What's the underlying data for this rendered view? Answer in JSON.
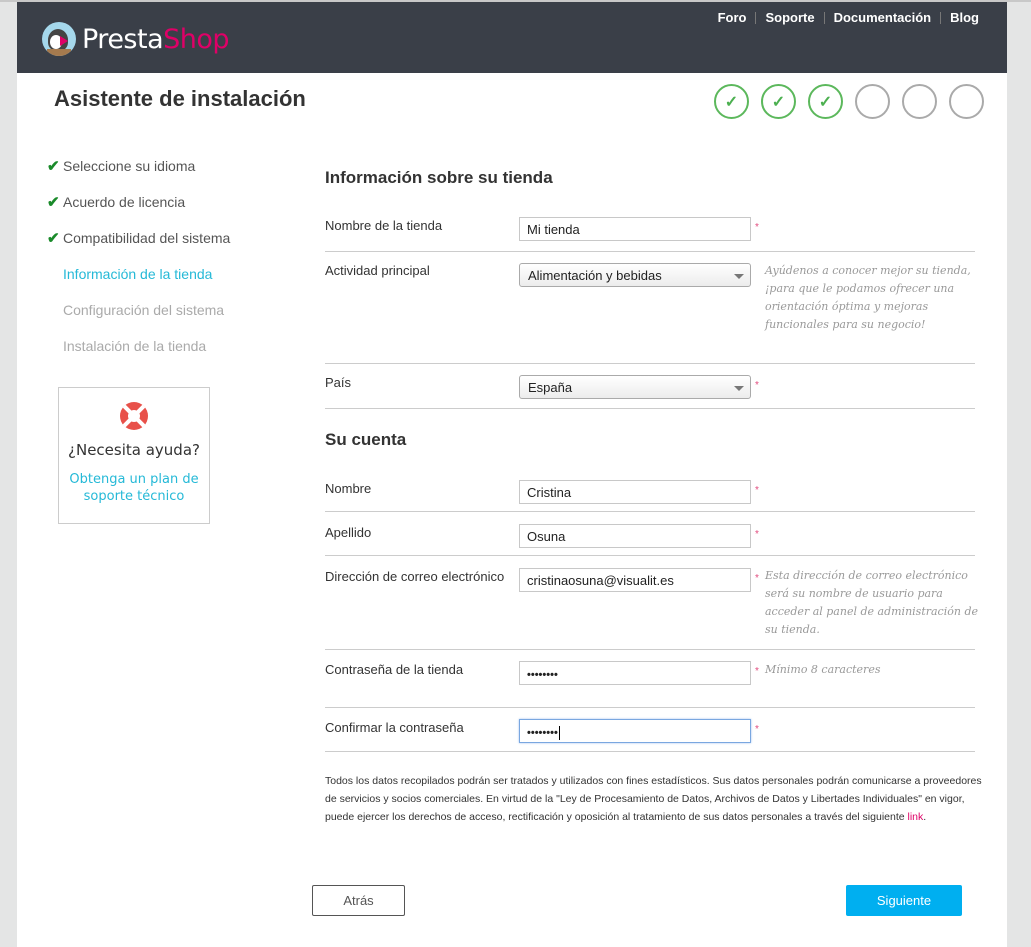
{
  "header": {
    "logo": {
      "part1": "Presta",
      "part2": "Shop"
    },
    "nav": [
      "Foro",
      "Soporte",
      "Documentación",
      "Blog"
    ]
  },
  "wizard": {
    "title": "Asistente de instalación",
    "progress": {
      "completed_steps": 3,
      "total_steps": 6
    },
    "step_check_glyph": "✓"
  },
  "sidebar": {
    "items": [
      {
        "label": "Seleccione su idioma",
        "state": "done"
      },
      {
        "label": "Acuerdo de licencia",
        "state": "done"
      },
      {
        "label": "Compatibilidad del sistema",
        "state": "done"
      },
      {
        "label": "Información de la tienda",
        "state": "current"
      },
      {
        "label": "Configuración del sistema",
        "state": "pending"
      },
      {
        "label": "Instalación de la tienda",
        "state": "pending"
      }
    ],
    "check_glyph": "✔"
  },
  "help": {
    "title": "¿Necesita ayuda?",
    "link": "Obtenga un plan de soporte técnico"
  },
  "store_section": {
    "title": "Información sobre su tienda",
    "store_name": {
      "label": "Nombre de la tienda",
      "value": "Mi tienda",
      "required": "*"
    },
    "activity": {
      "label": "Actividad principal",
      "value": "Alimentación y bebidas",
      "hint": "Ayúdenos a conocer mejor su tienda, ¡para que le podamos ofrecer una orientación óptima y mejoras funcionales para su negocio!"
    },
    "country": {
      "label": "País",
      "value": "España",
      "required": "*"
    }
  },
  "account_section": {
    "title": "Su cuenta",
    "first_name": {
      "label": "Nombre",
      "value": "Cristina",
      "required": "*"
    },
    "last_name": {
      "label": "Apellido",
      "value": "Osuna",
      "required": "*"
    },
    "email": {
      "label": "Dirección de correo electrónico",
      "value": "cristinaosuna@visualit.es",
      "required": "*",
      "hint": "Esta dirección de correo electrónico será su nombre de usuario para acceder al panel de administración de su tienda."
    },
    "password": {
      "label": "Contraseña de la tienda",
      "value": "••••••••",
      "required": "*",
      "hint": "Mínimo 8 caracteres"
    },
    "confirm_password": {
      "label": "Confirmar la contraseña",
      "value": "••••••••",
      "required": "*"
    }
  },
  "legal": {
    "text": "Todos los datos recopilados podrán ser tratados y utilizados con fines estadísticos. Sus datos personales podrán comunicarse a proveedores de servicios y socios comerciales. En virtud de la \"Ley de Procesamiento de Datos, Archivos de Datos y Libertades Individuales\" en vigor, puede ejercer los derechos de acceso, rectificación y oposición al tratamiento de sus datos personales a través del siguiente ",
    "link": "link",
    "end": "."
  },
  "buttons": {
    "back": "Atrás",
    "next": "Siguiente"
  },
  "colors": {
    "header_bg": "#3a3f48",
    "brand_pink": "#df0067",
    "accent_blue": "#25b9d7",
    "next_button": "#00aff0",
    "done_green": "#5cb85c"
  }
}
